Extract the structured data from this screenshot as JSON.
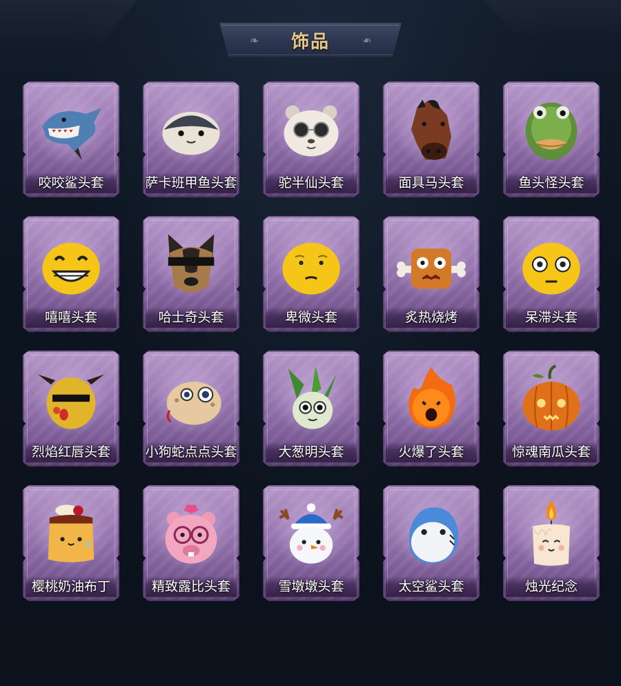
{
  "header": {
    "title": "饰品"
  },
  "items": [
    {
      "label": "咬咬鲨头套",
      "icon": "shark-mask-icon"
    },
    {
      "label": "萨卡班甲鱼头套",
      "icon": "sacabambaspis-mask-icon"
    },
    {
      "label": "驼半仙头套",
      "icon": "raccoon-sunglasses-mask-icon"
    },
    {
      "label": "面具马头套",
      "icon": "horse-mask-icon"
    },
    {
      "label": "鱼头怪头套",
      "icon": "fish-head-mask-icon"
    },
    {
      "label": "嘻嘻头套",
      "icon": "grin-emoji-mask-icon"
    },
    {
      "label": "哈士奇头套",
      "icon": "husky-sunglasses-mask-icon"
    },
    {
      "label": "卑微头套",
      "icon": "humble-emoji-mask-icon"
    },
    {
      "label": "炙热烧烤",
      "icon": "bbq-meat-bone-icon"
    },
    {
      "label": "呆滞头套",
      "icon": "dazed-emoji-mask-icon"
    },
    {
      "label": "烈焰红唇头套",
      "icon": "yellow-mouse-lips-mask-icon"
    },
    {
      "label": "小狗蛇点点头套",
      "icon": "puppy-snake-mask-icon"
    },
    {
      "label": "大葱明头套",
      "icon": "scallion-mask-icon"
    },
    {
      "label": "火爆了头套",
      "icon": "fire-spirit-mask-icon"
    },
    {
      "label": "惊魂南瓜头套",
      "icon": "pumpkin-mask-icon"
    },
    {
      "label": "樱桃奶油布丁",
      "icon": "cherry-pudding-icon"
    },
    {
      "label": "精致露比头套",
      "icon": "pink-beaver-glasses-mask-icon"
    },
    {
      "label": "雪墩墩头套",
      "icon": "snowman-antler-mask-icon"
    },
    {
      "label": "太空鲨头套",
      "icon": "space-shark-mask-icon"
    },
    {
      "label": "烛光纪念",
      "icon": "candle-icon"
    }
  ],
  "colors": {
    "background": "#0d1520",
    "title": "#e8c98a",
    "card": "#9a78b1",
    "label": "#ffffff"
  }
}
